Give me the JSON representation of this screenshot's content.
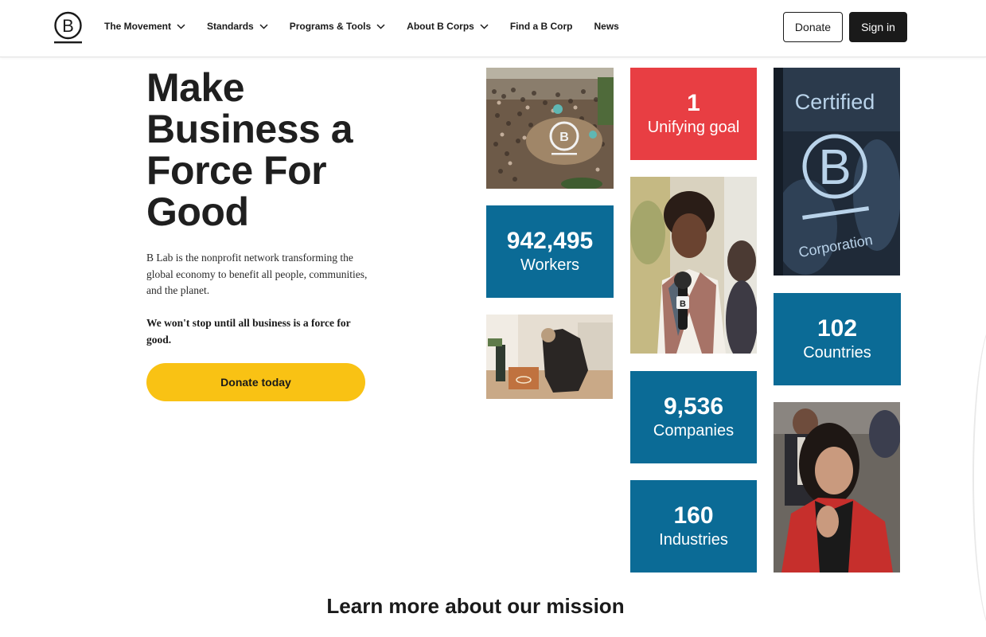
{
  "brand": {
    "logo_letter": "B"
  },
  "nav": {
    "items": [
      {
        "label": "The Movement",
        "dropdown": true
      },
      {
        "label": "Standards",
        "dropdown": true
      },
      {
        "label": "Programs & Tools",
        "dropdown": true
      },
      {
        "label": "About B Corps",
        "dropdown": true
      },
      {
        "label": "Find a B Corp",
        "dropdown": false
      },
      {
        "label": "News",
        "dropdown": false
      }
    ]
  },
  "header": {
    "donate_label": "Donate",
    "signin_label": "Sign in"
  },
  "hero": {
    "title": "Make Business a Force For Good",
    "description": "B Lab is the nonprofit network transforming the global economy to benefit all people, communities, and the planet.",
    "emphasis": "We won't stop until all business is a force for good.",
    "cta_label": "Donate today"
  },
  "stats": {
    "goal": {
      "number": "1",
      "label": "Unifying goal"
    },
    "workers": {
      "number": "942,495",
      "label": "Workers"
    },
    "companies": {
      "number": "9,536",
      "label": "Companies"
    },
    "industries": {
      "number": "160",
      "label": "Industries"
    },
    "countries": {
      "number": "102",
      "label": "Countries"
    }
  },
  "certified_sign": {
    "top_text": "Certified",
    "letter": "B",
    "bottom_text": "Corporation"
  },
  "mic_letter": "B",
  "mission": {
    "heading": "Learn more about our mission"
  },
  "colors": {
    "stat_blue": "#0b6b96",
    "stat_red": "#e83e43",
    "cta_yellow": "#f9c214",
    "text_dark": "#1a1a1a"
  }
}
